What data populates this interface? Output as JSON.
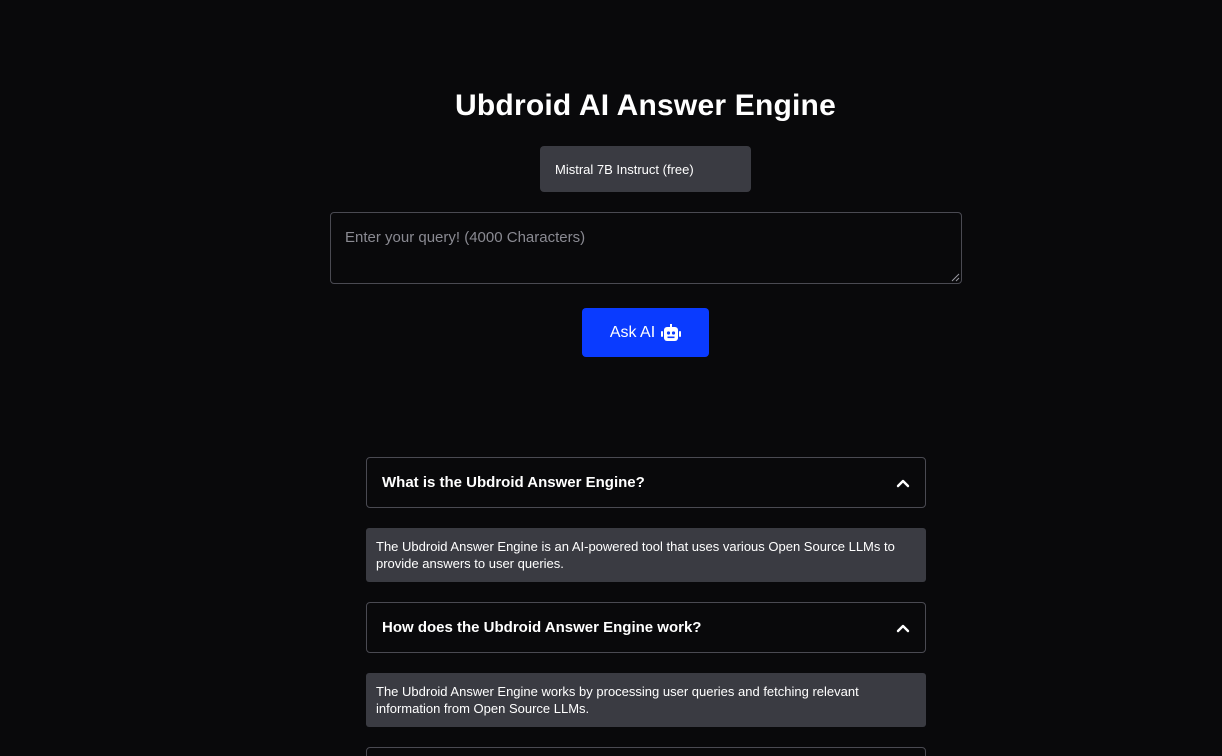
{
  "header": {
    "title": "Ubdroid AI Answer Engine"
  },
  "model_select": {
    "selected": "Mistral 7B Instruct (free)"
  },
  "query": {
    "placeholder": "Enter your query! (4000 Characters)",
    "value": ""
  },
  "ask_button": {
    "label": "Ask AI",
    "icon": "robot-icon"
  },
  "colors": {
    "background": "#09090b",
    "accent": "#0a3bff",
    "panel": "#3a3b42",
    "border": "#4a4a52"
  },
  "faq": [
    {
      "question": "What is the Ubdroid Answer Engine?",
      "answer": "The Ubdroid Answer Engine is an AI-powered tool that uses various Open Source LLMs to provide answers to user queries.",
      "icon": "chevron-up-icon"
    },
    {
      "question": "How does the Ubdroid Answer Engine work?",
      "answer": "The Ubdroid Answer Engine works by processing user queries and fetching relevant information from Open Source LLMs.",
      "icon": "chevron-up-icon"
    }
  ]
}
